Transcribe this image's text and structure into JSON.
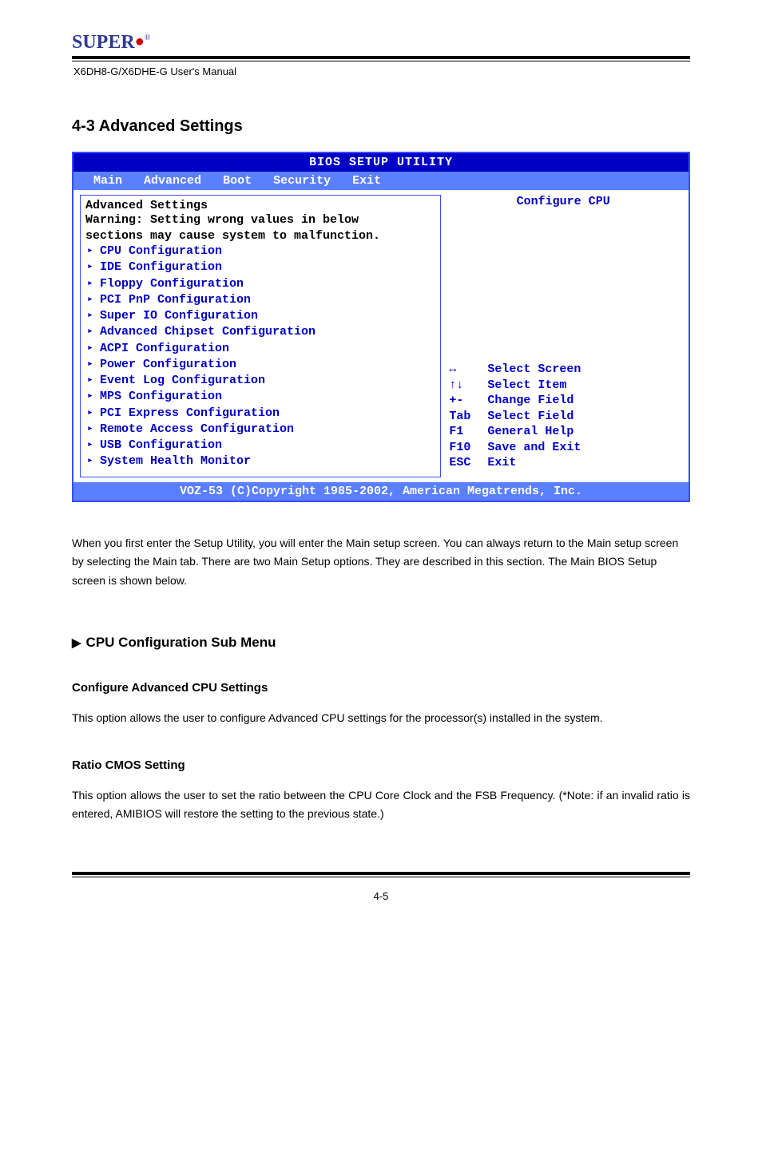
{
  "logo": {
    "text": "SUPER",
    "suffix": "®"
  },
  "doc_title": "X6DH8-G/X6DHE-G User's Manual",
  "section_heading": "4-3 Advanced Settings",
  "bios": {
    "title": "BIOS SETUP UTILITY",
    "tabs": [
      "Main",
      "Advanced",
      "Boot",
      "Security",
      "Exit"
    ],
    "left": {
      "heading": "Advanced Settings",
      "warning_line1": "Warning: Setting wrong values in below",
      "warning_line2": "sections may cause system to malfunction.",
      "menu_items": [
        "CPU Configuration",
        "IDE Configuration",
        "Floppy Configuration",
        "PCI PnP Configuration",
        "Super IO Configuration",
        "Advanced Chipset Configuration",
        "ACPI Configuration",
        "Power Configuration",
        "Event Log Configuration",
        "MPS Configuration",
        "PCI Express Configuration",
        "Remote Access Configuration",
        "USB Configuration",
        "System Health Monitor"
      ]
    },
    "right": {
      "top_text": "Configure CPU",
      "help": [
        {
          "key_sym": "↔",
          "label": "Select Screen"
        },
        {
          "key_sym": "↑↓",
          "label": "Select Item"
        },
        {
          "key_sym": "+-",
          "label": "Change Field"
        },
        {
          "key_sym": "Tab",
          "label": "Select Field"
        },
        {
          "key_sym": "F1",
          "label": "General Help"
        },
        {
          "key_sym": "F10",
          "label": "Save and Exit"
        },
        {
          "key_sym": "ESC",
          "label": "Exit"
        }
      ]
    },
    "copyright": "VOZ-53 (C)Copyright 1985-2002, American Megatrends, Inc."
  },
  "explain": "When you first enter the Setup Utility, you will enter the Main setup screen. You can always return to the Main setup screen by selecting the Main tab. There are two Main Setup options. They are described in this section. The Main BIOS Setup screen is shown below.",
  "sub_heading": "CPU Configuration Sub Menu",
  "setting_heading": "Configure Advanced CPU Settings",
  "setting_desc_1": "This option allows the user to configure Advanced CPU settings for the processor(s) installed in the system.",
  "setting_heading_2": "Ratio CMOS Setting",
  "setting_desc_2": "This option allows the user to set the ratio between the CPU Core Clock and the FSB Frequency. (*Note: if an invalid ratio is entered, AMIBIOS will restore the setting to the previous state.)",
  "page_num": "4-5"
}
